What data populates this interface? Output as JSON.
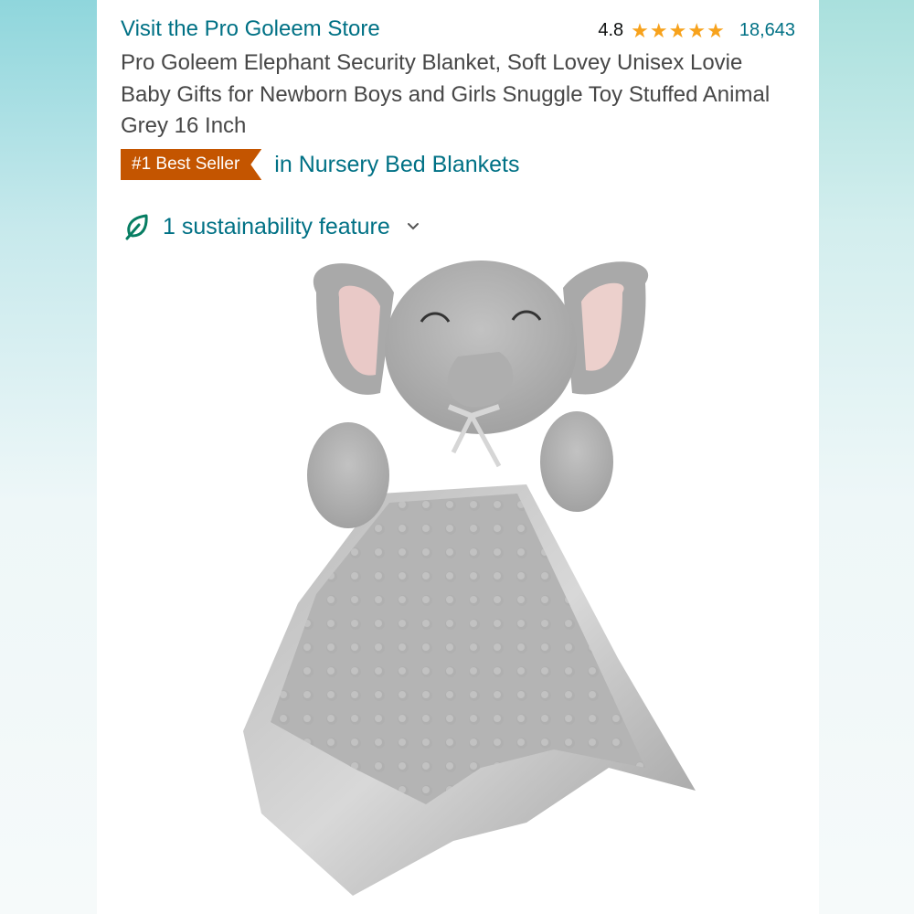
{
  "store": {
    "link_text": "Visit the Pro Goleem Store"
  },
  "rating": {
    "value": "4.8",
    "stars": 4.8,
    "count": "18,643",
    "star_color": "#f7a21c"
  },
  "product": {
    "title": "Pro Goleem Elephant Security Blanket, Soft Lovey Unisex Lovie Baby Gifts for Newborn Boys and Girls Snuggle Toy Stuffed Animal Grey 16 Inch",
    "image_alt": "grey elephant lovey security blanket"
  },
  "bestseller": {
    "badge": "#1 Best Seller",
    "category": "in Nursery Bed Blankets",
    "badge_color": "#c45500"
  },
  "sustainability": {
    "text": "1 sustainability feature",
    "icon": "leaf-icon",
    "chevron": "chevron-down-icon"
  },
  "colors": {
    "link": "#007185",
    "title_text": "#474747"
  }
}
